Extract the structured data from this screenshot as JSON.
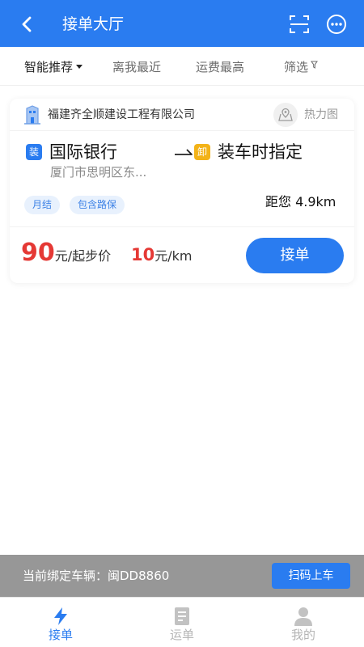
{
  "header": {
    "title": "接单大厅",
    "back_icon": "chevron-left-icon",
    "scan_icon": "scan-frame-icon",
    "more_icon": "more-dots-icon"
  },
  "filters": [
    {
      "label": "智能推荐",
      "active": true
    },
    {
      "label": "离我最近",
      "active": false
    },
    {
      "label": "运费最高",
      "active": false
    },
    {
      "label": "筛选",
      "active": false
    }
  ],
  "order": {
    "company": "福建齐全顺建设工程有限公司",
    "heat_map_label": "热力图",
    "load_badge": "装",
    "unload_badge": "卸",
    "from_name": "国际银行",
    "from_address": "厦门市思明区东...",
    "to_name": "装车时指定",
    "tags": [
      "月结",
      "包含路保"
    ],
    "distance": "距您 4.9km",
    "start_price": "90",
    "start_price_unit": "元/起步价",
    "per_km_price": "10",
    "per_km_unit": "元/km",
    "accept_label": "接单"
  },
  "bind_bar": {
    "text": "当前绑定车辆：闽DD8860",
    "scan_button": "扫码上车"
  },
  "tabs": [
    {
      "label": "接单",
      "icon": "lightning-icon",
      "active": true
    },
    {
      "label": "运单",
      "icon": "document-icon",
      "active": false
    },
    {
      "label": "我的",
      "icon": "person-icon",
      "active": false
    }
  ],
  "colors": {
    "primary": "#2a7cf0",
    "price_red": "#e53935",
    "unload_yellow": "#f3b318",
    "bind_bar_gray": "#979797"
  }
}
